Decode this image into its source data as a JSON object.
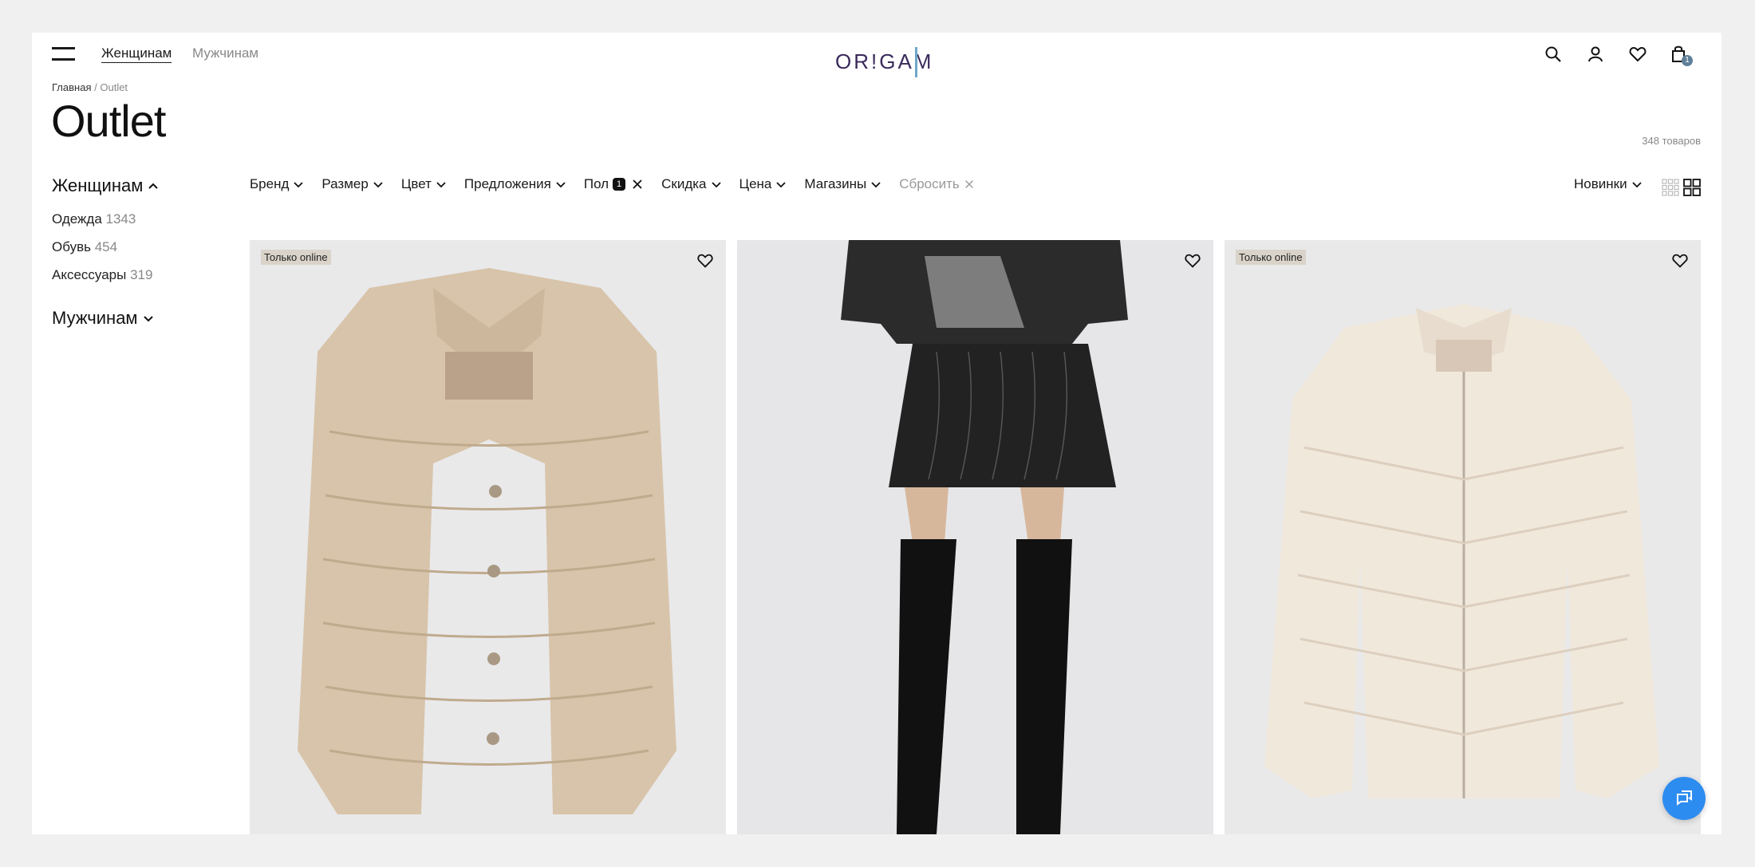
{
  "header": {
    "nav": [
      {
        "label": "Женщинам"
      },
      {
        "label": "Мужчинам"
      }
    ],
    "logo_text": "OR!GAM",
    "cart_count": "1"
  },
  "breadcrumb": {
    "home": "Главная",
    "separator": "/",
    "current": "Outlet"
  },
  "page": {
    "title": "Outlet",
    "count": "348 товаров"
  },
  "sidebar": {
    "women_heading": "Женщинам",
    "items": [
      {
        "label": "Одежда",
        "count": "1343"
      },
      {
        "label": "Обувь",
        "count": "454"
      },
      {
        "label": "Аксессуары",
        "count": "319"
      }
    ],
    "men_heading": "Мужчинам"
  },
  "filters": {
    "items": [
      "Бренд",
      "Размер",
      "Цвет",
      "Предложения"
    ],
    "gender": {
      "label": "Пол",
      "badge": "1"
    },
    "items2": [
      "Скидка",
      "Цена",
      "Магазины"
    ],
    "reset": "Сбросить"
  },
  "sort": {
    "label": "Новинки"
  },
  "products": [
    {
      "tag": "Только online",
      "image": "beige-puffer-jacket"
    },
    {
      "tag": "",
      "image": "black-skirt-boots-outfit"
    },
    {
      "tag": "Только online",
      "image": "cream-puffer-jacket"
    }
  ],
  "colors": {
    "accent": "#2d8cf0",
    "badge_bg": "#111111",
    "tag_bg": "#d9d3c9",
    "logo": "#3a2a5c"
  }
}
